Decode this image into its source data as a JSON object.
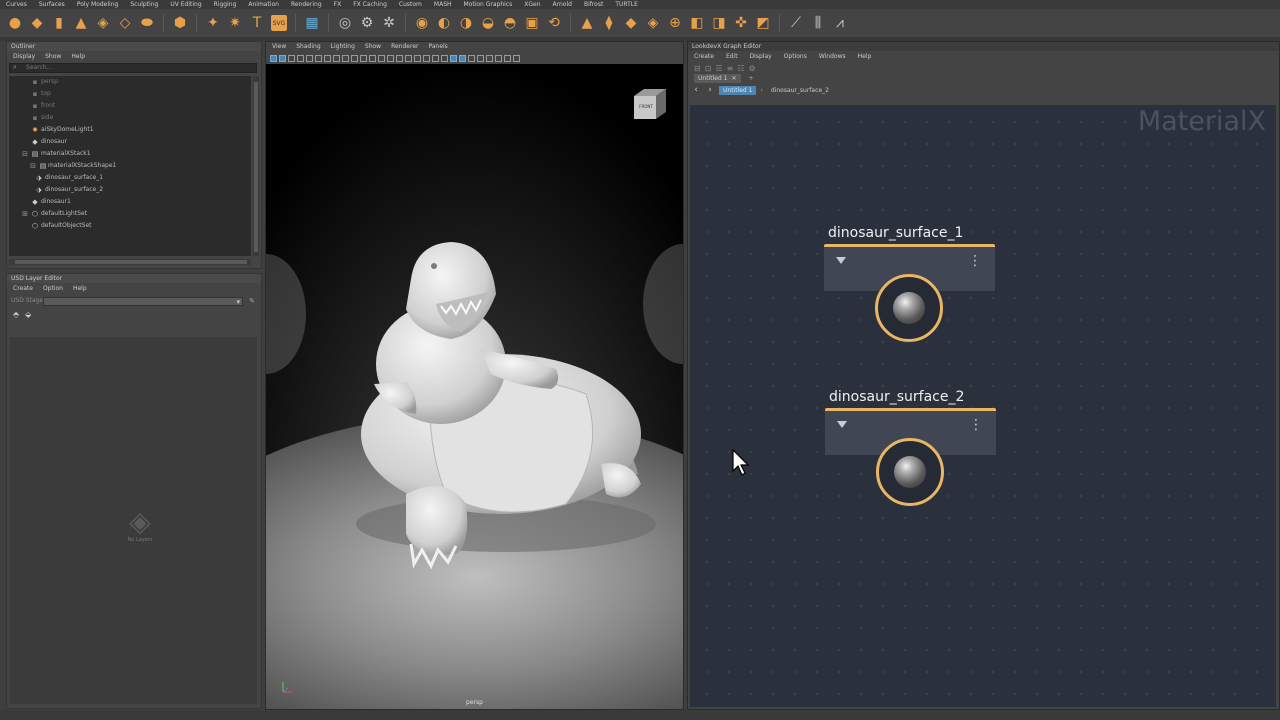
{
  "shelf_tabs": [
    "Curves",
    "Surfaces",
    "Poly Modeling",
    "Sculpting",
    "UV Editing",
    "Rigging",
    "Animation",
    "Rendering",
    "FX",
    "FX Caching",
    "Custom",
    "MASH",
    "Motion Graphics",
    "XGen",
    "Arnold",
    "Bifrost",
    "TURTLE"
  ],
  "shelf_icons": {
    "poly_text_glyph": "T",
    "svg_label": "SVG"
  },
  "outliner": {
    "title": "Outliner",
    "menu": [
      "Display",
      "Show",
      "Help"
    ],
    "search_placeholder": "Search...",
    "items": [
      {
        "label": "persp",
        "icon": "camera-icon"
      },
      {
        "label": "top",
        "icon": "camera-icon"
      },
      {
        "label": "front",
        "icon": "camera-icon"
      },
      {
        "label": "side",
        "icon": "camera-icon"
      },
      {
        "label": "aiSkyDomeLight1",
        "icon": "light-icon"
      },
      {
        "label": "dinosaur",
        "icon": "mesh-icon"
      },
      {
        "label": "materialXStack1",
        "icon": "stack-icon"
      },
      {
        "label": "materialXStackShape1",
        "icon": "stack-icon"
      },
      {
        "label": "dinosaur_surface_1",
        "icon": "material-icon"
      },
      {
        "label": "dinosaur_surface_2",
        "icon": "material-icon"
      },
      {
        "label": "dinosaur1",
        "icon": "mesh-icon"
      },
      {
        "label": "defaultLightSet",
        "icon": "set-icon"
      },
      {
        "label": "defaultObjectSet",
        "icon": "set-icon"
      }
    ]
  },
  "usd_layer_editor": {
    "title": "USD Layer Editor",
    "menu": [
      "Create",
      "Option",
      "Help"
    ],
    "stage_label": "USD Stage:",
    "empty_label": "No Layers"
  },
  "viewport": {
    "menu": [
      "View",
      "Shading",
      "Lighting",
      "Show",
      "Renderer",
      "Panels"
    ],
    "camera_label": "persp",
    "viewcube_label": "FRONT"
  },
  "graph_editor": {
    "title": "LookdevX Graph Editor",
    "menu": [
      "Create",
      "Edit",
      "Display",
      "Options",
      "Windows",
      "Help"
    ],
    "tab_label": "Untitled 1",
    "breadcrumbs": [
      "Untitled 1",
      "dinosaur_surface_2"
    ],
    "watermark": "MaterialX",
    "nodes": [
      {
        "name": "dinosaur_surface_1"
      },
      {
        "name": "dinosaur_surface_2"
      }
    ]
  },
  "colors": {
    "accent_orange": "#e8b664",
    "canvas_bg": "#2b303d",
    "selection_blue": "#4b86b4"
  }
}
